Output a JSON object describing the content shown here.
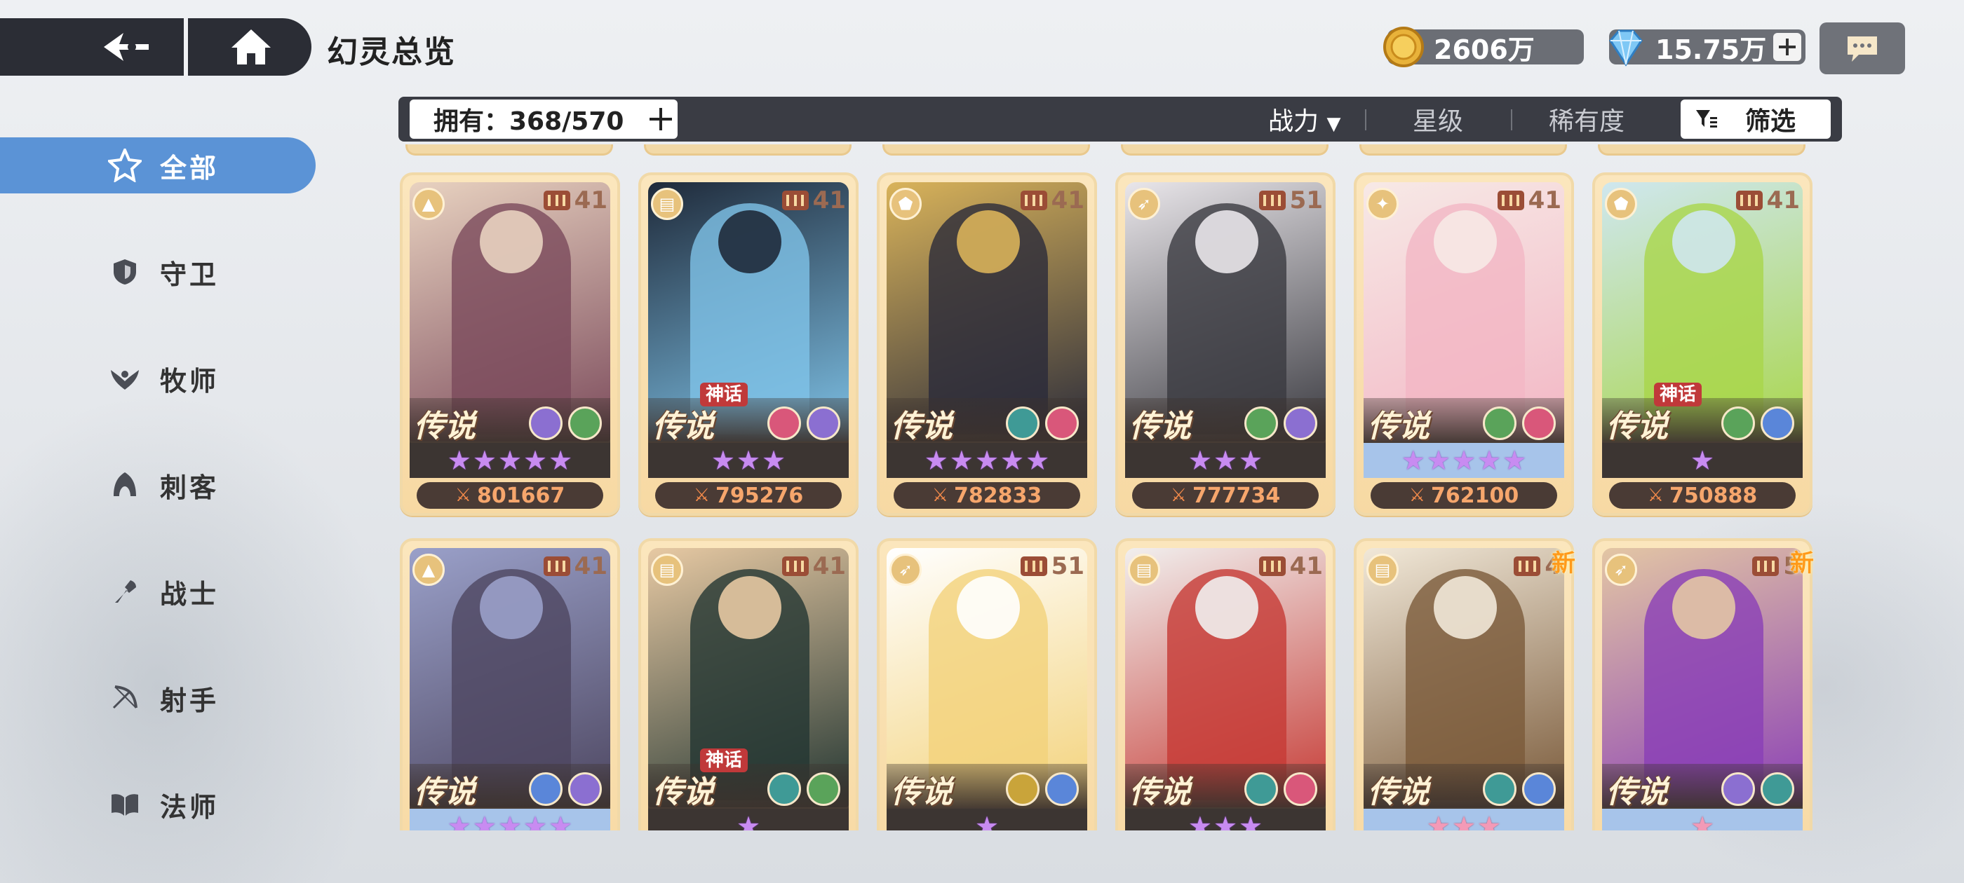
{
  "header": {
    "title": "幻灵总览",
    "gold": "2606万",
    "gems": "15.75万"
  },
  "toolbar": {
    "owned": "拥有：368/570",
    "sort_power": "战力",
    "sort_power_arrow": "▼",
    "sort_star": "星级",
    "sort_rarity": "稀有度",
    "filter": "筛选"
  },
  "sidebar": {
    "items": [
      {
        "label": "全部",
        "icon": "all-star-icon"
      },
      {
        "label": "守卫",
        "icon": "shield-icon"
      },
      {
        "label": "牧师",
        "icon": "priest-wing-icon"
      },
      {
        "label": "刺客",
        "icon": "assassin-hood-icon"
      },
      {
        "label": "战士",
        "icon": "warrior-axe-icon"
      },
      {
        "label": "射手",
        "icon": "archer-bow-icon"
      },
      {
        "label": "法师",
        "icon": "mage-book-icon"
      }
    ]
  },
  "colors": {
    "active_tab": "#5b93d6",
    "card_frame": "#f7d9a3",
    "power_text": "#f6a66c",
    "myth_badge": "#c0393a",
    "new_badge": "#ff9a1a"
  },
  "cards": [
    {
      "rank": "传说",
      "level": "41",
      "stars": 5,
      "star_color": "purple",
      "power": "801667",
      "myth": "",
      "new": "",
      "class_icon": "assassin-icon",
      "elements": [
        "violet-eye-icon",
        "green-leaf-icon"
      ],
      "art": "#7b4a5b",
      "art2": "#e8d2c0",
      "bluebar": false
    },
    {
      "rank": "传说",
      "level": "41",
      "stars": 3,
      "star_color": "purple",
      "power": "795276",
      "myth": "神话",
      "new": "",
      "class_icon": "mage-icon",
      "elements": [
        "pink-swirl-icon",
        "violet-eye-icon"
      ],
      "art": "#7fc3e8",
      "art2": "#1f2a3a",
      "bluebar": false
    },
    {
      "rank": "传说",
      "level": "41",
      "stars": 5,
      "star_color": "purple",
      "power": "782833",
      "myth": "",
      "new": "",
      "class_icon": "guardian-icon",
      "elements": [
        "teal-infinity-icon",
        "pink-swirl-icon"
      ],
      "art": "#2a2b3a",
      "art2": "#d9b35a",
      "bluebar": false
    },
    {
      "rank": "传说",
      "level": "51",
      "stars": 3,
      "star_color": "purple",
      "power": "777734",
      "myth": "",
      "new": "",
      "class_icon": "archer-icon",
      "elements": [
        "green-leaf-icon",
        "violet-eye-icon"
      ],
      "art": "#3a3a40",
      "art2": "#e9e6ea",
      "bluebar": false
    },
    {
      "rank": "传说",
      "level": "41",
      "stars": 5,
      "star_color": "purple",
      "power": "762100",
      "myth": "",
      "new": "",
      "class_icon": "priest-icon",
      "elements": [
        "green-leaf-icon",
        "pink-swirl-icon"
      ],
      "art": "#f2b6c4",
      "art2": "#f7e9e6",
      "bluebar": true
    },
    {
      "rank": "传说",
      "level": "41",
      "stars": 1,
      "star_color": "purple",
      "power": "750888",
      "myth": "神话",
      "new": "",
      "class_icon": "guardian-icon",
      "elements": [
        "green-leaf-icon",
        "blue-star-icon"
      ],
      "art": "#a9d64a",
      "art2": "#cfe7ef",
      "bluebar": false
    },
    {
      "rank": "传说",
      "level": "41",
      "stars": 5,
      "star_color": "purple",
      "power": "",
      "myth": "",
      "new": "",
      "class_icon": "assassin-icon",
      "elements": [
        "blue-star-icon",
        "violet-eye-icon"
      ],
      "art": "#4d4660",
      "art2": "#9aa0c9",
      "bluebar": true
    },
    {
      "rank": "传说",
      "level": "41",
      "stars": 1,
      "star_color": "purple",
      "power": "",
      "myth": "神话",
      "new": "",
      "class_icon": "mage-icon",
      "elements": [
        "teal-infinity-icon",
        "green-leaf-icon"
      ],
      "art": "#233632",
      "art2": "#e7c9a3",
      "bluebar": false
    },
    {
      "rank": "传说",
      "level": "51",
      "stars": 1,
      "star_color": "purple",
      "power": "",
      "myth": "",
      "new": "",
      "class_icon": "archer-icon",
      "elements": [
        "gold-wing-icon",
        "blue-star-icon"
      ],
      "art": "#f3d27a",
      "art2": "#ffffff",
      "bluebar": false
    },
    {
      "rank": "传说",
      "level": "41",
      "stars": 3,
      "star_color": "purple",
      "power": "",
      "myth": "",
      "new": "",
      "class_icon": "mage-icon",
      "elements": [
        "teal-infinity-icon",
        "pink-swirl-icon"
      ],
      "art": "#c63a34",
      "art2": "#f1efee",
      "bluebar": false
    },
    {
      "rank": "传说",
      "level": "4",
      "stars": 3,
      "star_color": "pink",
      "power": "",
      "myth": "",
      "new": "新",
      "class_icon": "mage-icon",
      "elements": [
        "teal-infinity-icon",
        "blue-star-icon"
      ],
      "art": "#7a5a3a",
      "art2": "#f1e8d8",
      "bluebar": true
    },
    {
      "rank": "传说",
      "level": "5",
      "stars": 1,
      "star_color": "pink",
      "power": "",
      "myth": "",
      "new": "新",
      "class_icon": "archer-icon",
      "elements": [
        "violet-eye-icon",
        "teal-infinity-icon"
      ],
      "art": "#8a3fb6",
      "art2": "#e3c6a4",
      "bluebar": true
    }
  ]
}
